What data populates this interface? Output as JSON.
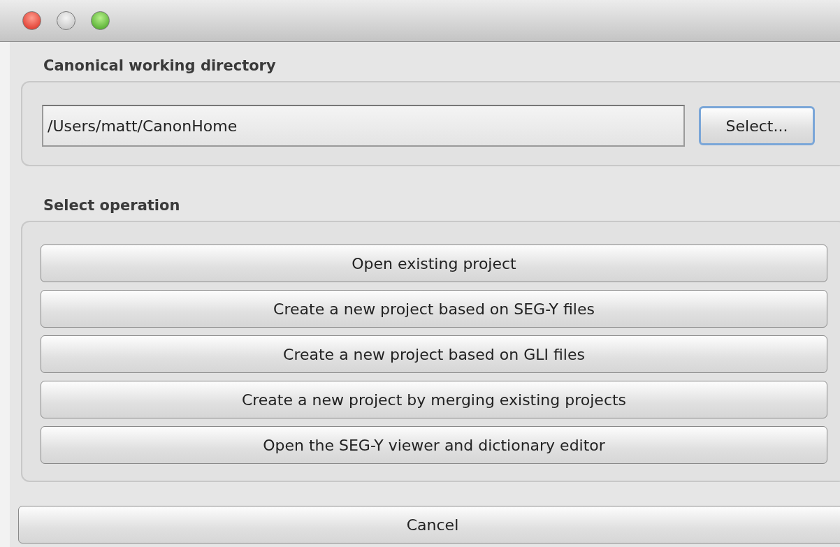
{
  "window": {
    "controls": [
      {
        "kind": "close"
      },
      {
        "kind": "minimize"
      },
      {
        "kind": "zoom"
      }
    ]
  },
  "directory": {
    "label": "Canonical working directory",
    "value": "/Users/matt/CanonHome",
    "button": {
      "label": "Select...",
      "focused": true
    }
  },
  "operations": {
    "label": "Select operation",
    "buttons": [
      {
        "label": "Open existing project"
      },
      {
        "label": "Create a new project based on SEG-Y files"
      },
      {
        "label": "Create a new project based on GLI files"
      },
      {
        "label": "Create a new project by merging existing projects"
      },
      {
        "label": "Open the SEG-Y viewer and dictionary editor"
      }
    ]
  },
  "cancel": {
    "label": "Cancel"
  }
}
